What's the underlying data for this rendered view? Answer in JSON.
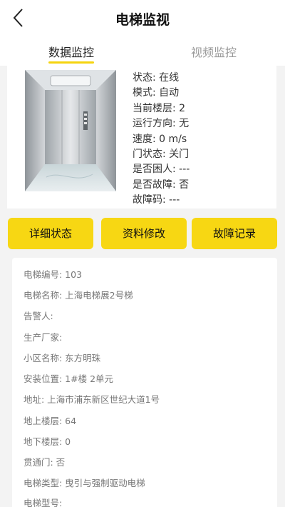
{
  "header": {
    "title": "电梯监视"
  },
  "tabs": [
    {
      "label": "数据监控"
    },
    {
      "label": "视频监控"
    }
  ],
  "status": {
    "lines": [
      "状态: 在线",
      "模式: 自动",
      "当前楼层: 2",
      "运行方向: 无",
      "速度: 0 m/s",
      "门状态: 关门",
      "是否困人: ---",
      "是否故障: 否",
      "故障码: ---"
    ]
  },
  "buttons": {
    "detail": "详细状态",
    "edit": "资料修改",
    "fault": "故障记录"
  },
  "details": [
    "电梯编号: 103",
    "电梯名称: 上海电梯展2号梯",
    "告警人:",
    "生产厂家:",
    "小区名称: 东方明珠",
    "安装位置: 1#楼 2单元",
    "地址: 上海市浦东新区世纪大道1号",
    "地上楼层: 64",
    "地下楼层: 0",
    "贯通门: 否",
    "电梯类型: 曳引与强制驱动电梯",
    "电梯型号:"
  ],
  "colors": {
    "accent": "#f7d713",
    "background": "#f3f3f3"
  }
}
